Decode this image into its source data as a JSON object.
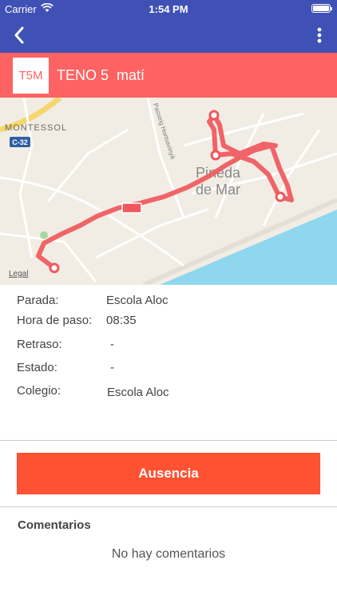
{
  "status_bar": {
    "carrier": "Carrier",
    "time": "1:54 PM",
    "wifi_icon": "wifi-icon",
    "battery_icon": "battery-icon"
  },
  "nav": {
    "back_icon": "chevron-left-icon",
    "more_icon": "more-vertical-icon"
  },
  "route": {
    "badge": "T5M",
    "title": "TENO 5  matí"
  },
  "map": {
    "labels": {
      "montessol": "MONTESSOL",
      "road_c32": "C-32",
      "town_line1": "Pineda",
      "town_line2": "de Mar",
      "street": "Passeig Hortsavinyà",
      "legal": "Legal"
    },
    "colors": {
      "route": "#f0585d",
      "sea": "#8fd7ee",
      "land": "#f1ede4",
      "road": "#ffffff"
    }
  },
  "details": {
    "stop_label": "Parada:",
    "stop_value": "Escola Aloc",
    "time_label": "Hora de paso:",
    "time_value": "08:35",
    "delay_label": "Retraso:",
    "delay_value": "-",
    "status_label": "Estado:",
    "status_value": "-",
    "school_label": "Colegio:",
    "school_value": "Escola Aloc"
  },
  "actions": {
    "absence_label": "Ausencia"
  },
  "comments": {
    "title": "Comentarios",
    "empty": "No hay comentarios"
  },
  "colors": {
    "nav": "#3f51b5",
    "header": "#ff6262",
    "button": "#ff5233"
  }
}
